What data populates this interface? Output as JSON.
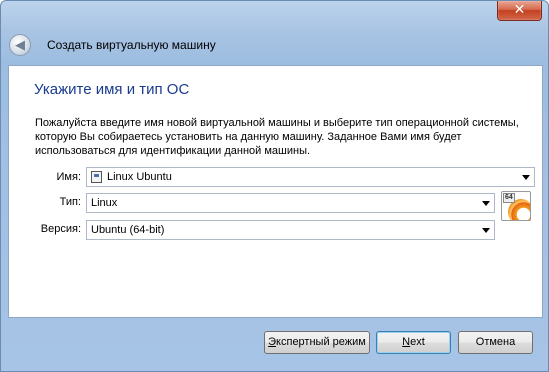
{
  "window": {
    "close_glyph": "✕"
  },
  "wizard": {
    "back_glyph": "◀",
    "title": "Создать виртуальную машину",
    "heading": "Укажите имя и тип ОС",
    "description": "Пожалуйста введите имя новой виртуальной машины и выберите тип операционной системы, которую Вы собираетесь установить на данную машину. Заданное Вами имя будет использоваться для идентификации данной машины."
  },
  "form": {
    "name_label": "Имя:",
    "name_value": "Linux Ubuntu",
    "type_label": "Тип:",
    "type_value": "Linux",
    "version_label": "Версия:",
    "version_value": "Ubuntu (64-bit)",
    "os_badge": "64",
    "os_icon": "ubuntu-icon"
  },
  "buttons": {
    "expert_first": "Э",
    "expert_rest": "кспертный режим",
    "next_first": "N",
    "next_rest": "ext",
    "cancel": "Отмена"
  },
  "colors": {
    "heading": "#1a3c8f",
    "titlebar": "#a9c4e3",
    "close": "#c2401f"
  }
}
